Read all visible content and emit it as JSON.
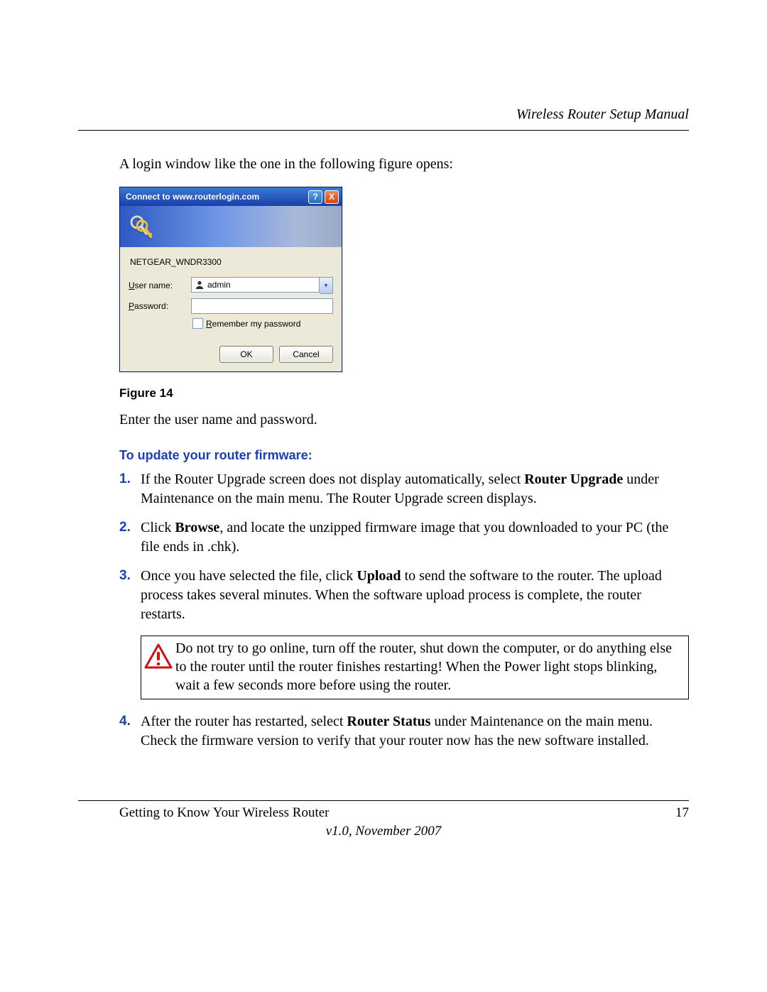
{
  "header": {
    "running_title": "Wireless Router Setup Manual"
  },
  "intro_line": "A login window like the one in the following figure opens:",
  "dialog": {
    "title": "Connect to www.routerlogin.com",
    "help_icon": "?",
    "close_icon": "X",
    "description": "NETGEAR_WNDR3300",
    "username_label_pre": "U",
    "username_label_rest": "ser name:",
    "username_value": "admin",
    "password_label_pre": "P",
    "password_label_rest": "assword:",
    "password_value": "",
    "dropdown_glyph": "▾",
    "remember_pre": "R",
    "remember_rest": "emember my password",
    "ok_label": "OK",
    "cancel_label": "Cancel"
  },
  "figure_caption": "Figure 14",
  "after_figure": "Enter the user name and password.",
  "section_heading": "To update your router firmware:",
  "step1": {
    "pre": "If the Router Upgrade screen does not display automatically, select ",
    "bold": "Router Upgrade",
    "post": " under Maintenance on the main menu. The Router Upgrade screen displays."
  },
  "step2": {
    "pre": "Click ",
    "bold": "Browse",
    "post": ", and locate the unzipped firmware image that you downloaded to your PC (the file ends in .chk)."
  },
  "step3": {
    "pre": "Once you have selected the file, click ",
    "bold": "Upload",
    "post": " to send the software to the router. The upload process takes several minutes. When the software upload process is complete, the router restarts."
  },
  "warning_text": "Do not try to go online, turn off the router, shut down the computer, or do anything else to the router until the router finishes restarting! When the Power light stops blinking, wait a few seconds more before using the router.",
  "step4": {
    "pre": "After the router has restarted, select ",
    "bold": "Router Status",
    "post": " under Maintenance on the main menu. Check the firmware version to verify that your router now has the new software installed."
  },
  "footer": {
    "section": "Getting to Know Your Wireless Router",
    "page": "17",
    "version": "v1.0, November 2007"
  }
}
